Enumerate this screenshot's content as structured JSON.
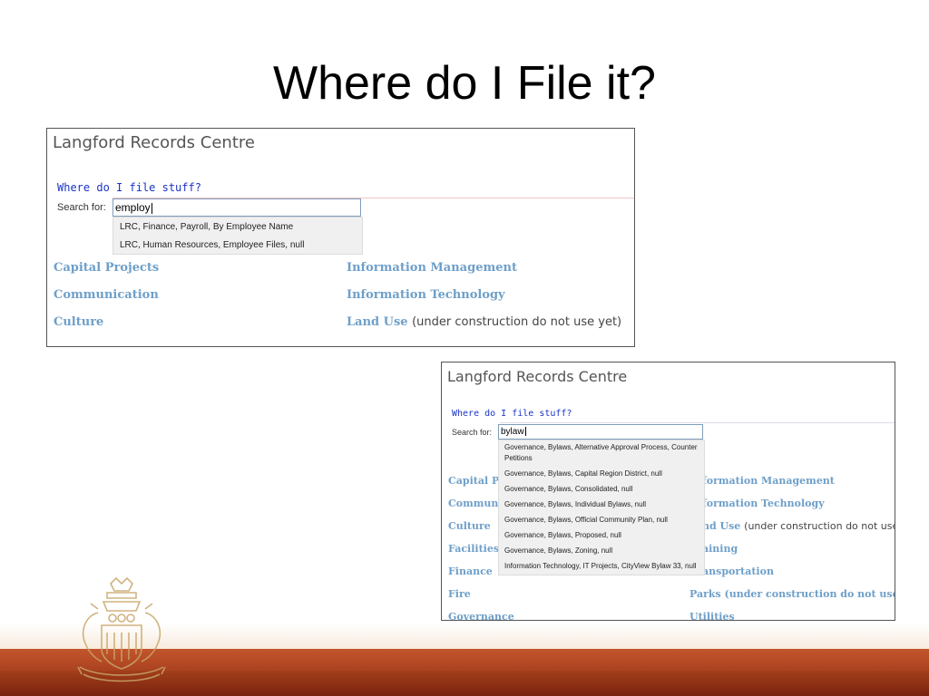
{
  "slide": {
    "title": "Where do I File it?"
  },
  "panel_a": {
    "brand": "Langford Records Centre",
    "where_link": "Where do I file stuff?",
    "search_label": "Search for:",
    "search_value": "employ",
    "suggestions": [
      "LRC, Finance, Payroll, By Employee Name",
      "LRC, Human Resources, Employee Files, null"
    ],
    "categories": {
      "capital_projects": "Capital Projects",
      "communication": "Communication",
      "culture": "Culture",
      "information_management": "Information Management",
      "information_technology": "Information Technology",
      "land_use": "Land Use",
      "land_use_note": "(under construction do not use yet)"
    }
  },
  "panel_b": {
    "brand": "Langford Records Centre",
    "where_link": "Where do I file stuff?",
    "search_label": "Search for:",
    "search_value": "bylaw",
    "suggestions": [
      "Governance, Bylaws, Alternative Approval Process, Counter Petitions",
      "Governance, Bylaws, Capital Region District, null",
      "Governance, Bylaws, Consolidated, null",
      "Governance, Bylaws, Individual Bylaws, null",
      "Governance, Bylaws, Official Community Plan, null",
      "Governance, Bylaws, Proposed, null",
      "Governance, Bylaws, Zoning, null",
      "Information Technology, IT Projects, CityView Bylaw 33, null"
    ],
    "left_categories": {
      "capital": "Capital Pr",
      "communication": "Communi",
      "culture": "Culture",
      "facilities": "Facilities",
      "finance": "Finance",
      "fire": "Fire",
      "governance": "Governance"
    },
    "right_categories": {
      "information_management": "formation Management",
      "information_technology": "formation Technology",
      "land_use": "nd Use",
      "land_use_note": "(under construction do not use",
      "training": "aining",
      "transportation": "ansportation",
      "parks": "Parks (under construction do not use)",
      "utilities": "Utilities"
    }
  },
  "colors": {
    "category_link": "#6e9fc9",
    "where_link": "#1a33c4",
    "ground_band": "#a23f1a"
  },
  "icons": {
    "crest": "municipal-coat-of-arms-icon"
  }
}
